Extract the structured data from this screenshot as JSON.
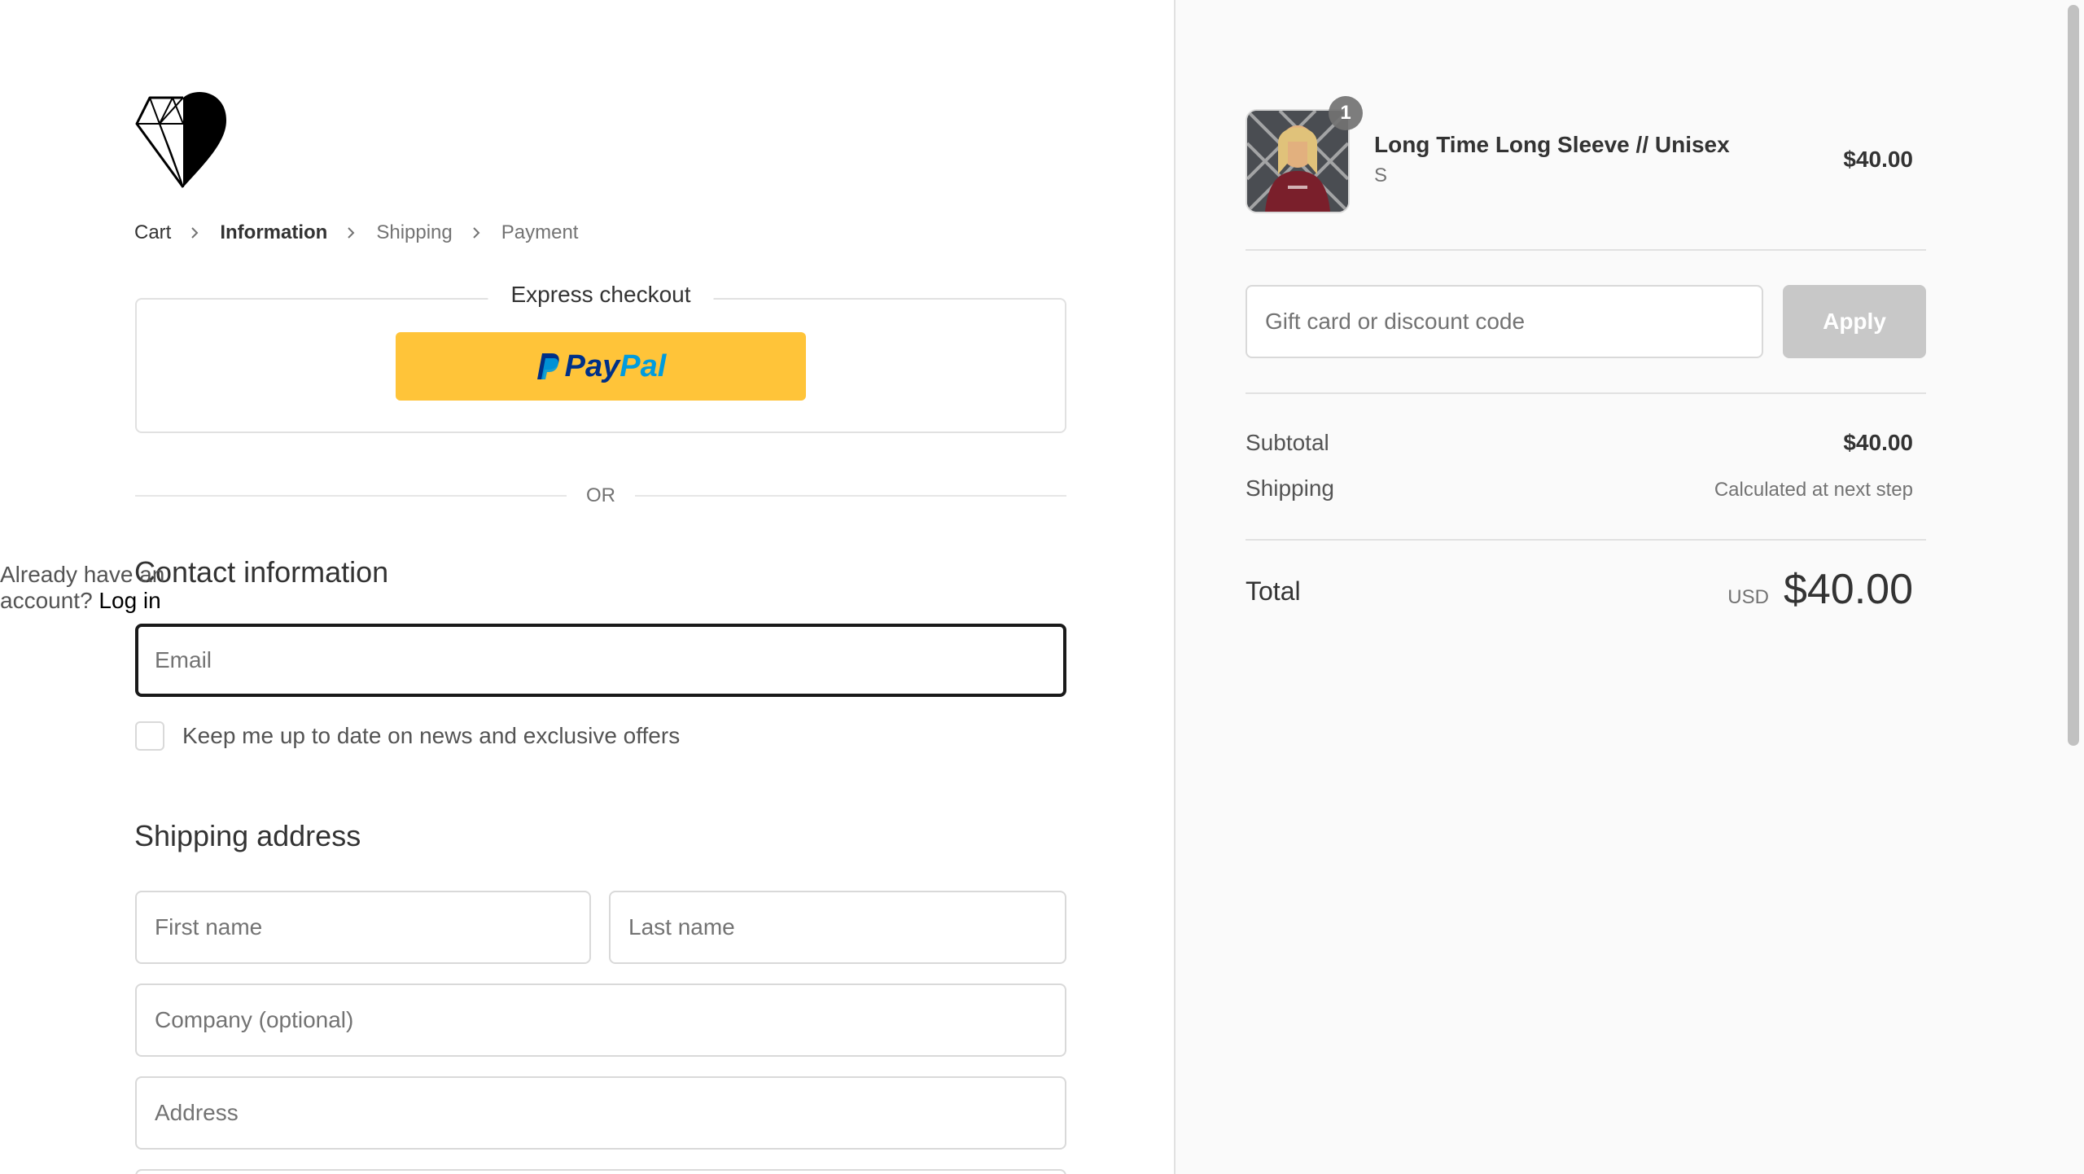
{
  "breadcrumb": {
    "items": [
      "Cart",
      "Information",
      "Shipping",
      "Payment"
    ]
  },
  "express": {
    "title": "Express checkout",
    "paypal_pay": "Pay",
    "paypal_pal": "Pal"
  },
  "divider_or": "OR",
  "contact": {
    "title": "Contact information",
    "account_prompt": "Already have an account?",
    "login_label": "Log in",
    "email_placeholder": "Email",
    "newsletter_label": "Keep me up to date on news and exclusive offers"
  },
  "shipping_address": {
    "title": "Shipping address",
    "first_name_placeholder": "First name",
    "last_name_placeholder": "Last name",
    "company_placeholder": "Company (optional)",
    "address_placeholder": "Address"
  },
  "order": {
    "item": {
      "quantity": "1",
      "name": "Long Time Long Sleeve // Unisex",
      "variant": "S",
      "price": "$40.00"
    },
    "discount_placeholder": "Gift card or discount code",
    "apply_label": "Apply",
    "subtotal_label": "Subtotal",
    "subtotal_value": "$40.00",
    "shipping_label": "Shipping",
    "shipping_value": "Calculated at next step",
    "total_label": "Total",
    "total_currency": "USD",
    "total_value": "$40.00"
  },
  "colors": {
    "paypal_yellow": "#ffc439",
    "focus_border": "#1a1a1a",
    "apply_disabled": "#c8c8c8",
    "sidebar_bg": "#fafafa"
  }
}
